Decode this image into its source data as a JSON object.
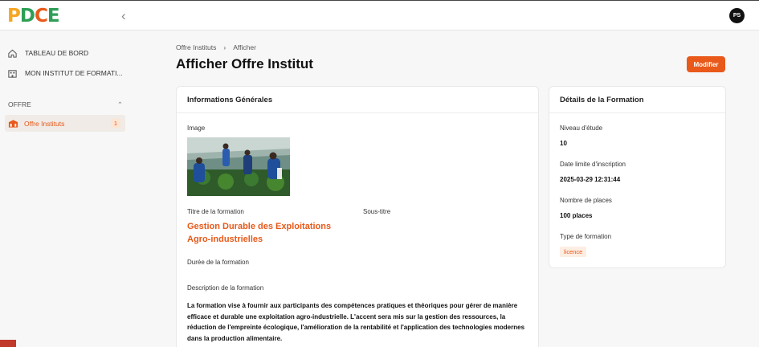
{
  "app": {
    "logo_text": "PDCE",
    "user_initials": "PS"
  },
  "sidebar": {
    "items": [
      {
        "label": "TABLEAU DE BORD",
        "icon": "home-icon"
      },
      {
        "label": "MON INSTITUT DE FORMATI...",
        "icon": "building-icon"
      }
    ],
    "section_label": "OFFRE",
    "active_item": {
      "label": "Offre Instituts",
      "count": "1",
      "icon": "offer-icon"
    }
  },
  "breadcrumb": {
    "items": [
      "Offre Instituts",
      "Afficher"
    ],
    "separator": "›"
  },
  "page": {
    "title": "Afficher Offre Institut",
    "edit_label": "Modifier"
  },
  "general": {
    "heading": "Informations Générales",
    "image_label": "Image",
    "title_label": "Titre de la formation",
    "title_value": "Gestion Durable des Exploitations Agro-industrielles",
    "subtitle_label": "Sous-titre",
    "duration_label": "Durée de la formation",
    "description_label": "Description de la formation",
    "description": "La formation vise à fournir aux participants des compétences pratiques et théoriques pour gérer de manière efficace et durable une exploitation agro-industrielle. L'accent sera mis sur la gestion des ressources, la réduction de l'empreinte écologique, l'amélioration de la rentabilité et l'application des technologies modernes dans la production alimentaire."
  },
  "details": {
    "heading": "Détails de la Formation",
    "level_label": "Niveau d'étude",
    "level_value": "10",
    "deadline_label": "Date limite d'inscription",
    "deadline_value": "2025-03-29 12:31:44",
    "places_label": "Nombre de places",
    "places_value": "100 places",
    "type_label": "Type de formation",
    "type_value": "licence"
  },
  "colors": {
    "accent": "#e8591a",
    "brand_green": "#2e9e57",
    "brand_yellow": "#f5a623"
  }
}
